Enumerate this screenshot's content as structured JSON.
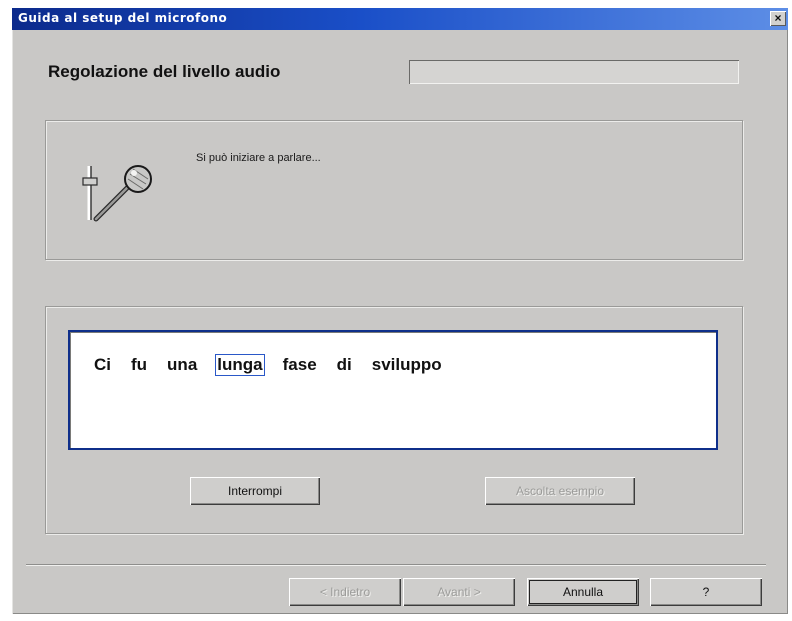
{
  "window": {
    "title": "Guida al setup del microfono",
    "close_glyph": "×"
  },
  "header": {
    "title": "Regolazione del livello audio",
    "level_meter_fraction": 0.0
  },
  "status": {
    "message": "Si può iniziare a parlare...",
    "icon": "microphone-level-icon"
  },
  "sample": {
    "words": [
      "Ci",
      "fu",
      "una",
      "lunga",
      "fase",
      "di",
      "sviluppo"
    ],
    "current_word_index": 3
  },
  "buttons": {
    "interrompi": "Interrompi",
    "ascolta_esempio": "Ascolta esempio",
    "indietro": "< Indietro",
    "avanti": "Avanti >",
    "annulla": "Annulla",
    "help": "?"
  },
  "colors": {
    "titlebar": "#1a4fc8",
    "dialog_bg": "#c9c8c6",
    "text_box_border": "#0f2f8a"
  }
}
